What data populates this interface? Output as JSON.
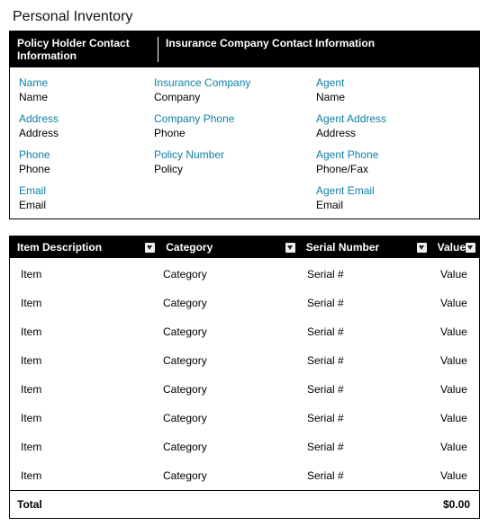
{
  "title": "Personal Inventory",
  "contact_headers": {
    "policy_holder": "Policy Holder Contact Information",
    "insurance_company": "Insurance Company Contact Information"
  },
  "contact_rows": [
    [
      {
        "label": "Name",
        "value": "Name"
      },
      {
        "label": "Insurance Company",
        "value": "Company"
      },
      {
        "label": "Agent",
        "value": "Name"
      }
    ],
    [
      {
        "label": "Address",
        "value": "Address"
      },
      {
        "label": "Company Phone",
        "value": "Phone"
      },
      {
        "label": "Agent Address",
        "value": "Address"
      }
    ],
    [
      {
        "label": "Phone",
        "value": "Phone"
      },
      {
        "label": "Policy Number",
        "value": "Policy"
      },
      {
        "label": "Agent Phone",
        "value": "Phone/Fax"
      }
    ],
    [
      {
        "label": "Email",
        "value": "Email"
      },
      null,
      {
        "label": "Agent Email",
        "value": "Email"
      }
    ]
  ],
  "inventory_headers": {
    "item": "Item Description",
    "category": "Category",
    "serial": "Serial Number",
    "value": "Value"
  },
  "inventory_rows": [
    {
      "item": "Item",
      "category": "Category",
      "serial": "Serial #",
      "value": "Value"
    },
    {
      "item": "Item",
      "category": "Category",
      "serial": "Serial #",
      "value": "Value"
    },
    {
      "item": "Item",
      "category": "Category",
      "serial": "Serial #",
      "value": "Value"
    },
    {
      "item": "Item",
      "category": "Category",
      "serial": "Serial #",
      "value": "Value"
    },
    {
      "item": "Item",
      "category": "Category",
      "serial": "Serial #",
      "value": "Value"
    },
    {
      "item": "Item",
      "category": "Category",
      "serial": "Serial #",
      "value": "Value"
    },
    {
      "item": "Item",
      "category": "Category",
      "serial": "Serial #",
      "value": "Value"
    },
    {
      "item": "Item",
      "category": "Category",
      "serial": "Serial #",
      "value": "Value"
    }
  ],
  "total": {
    "label": "Total",
    "value": "$0.00"
  }
}
